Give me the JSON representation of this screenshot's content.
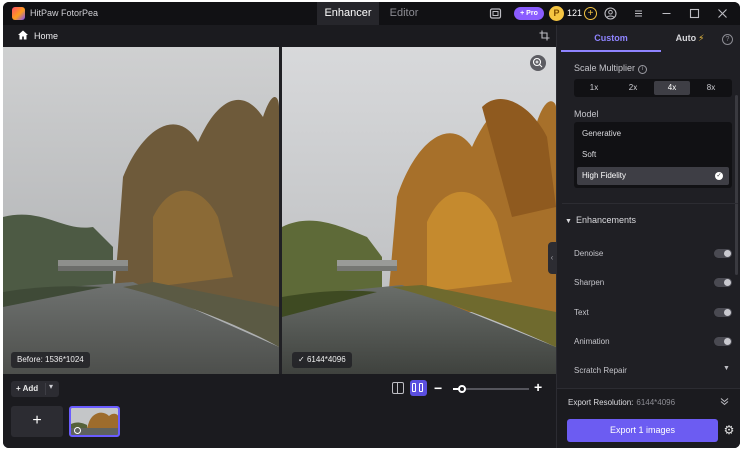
{
  "app": {
    "title": "HitPaw FotorPea",
    "tabs": [
      {
        "label": "Enhancer",
        "active": true
      },
      {
        "label": "Editor",
        "active": false
      }
    ],
    "pro_label": "+ Pro",
    "credits": "121",
    "icons": [
      "screen-icon",
      "coin-icon",
      "add-credits-icon",
      "account-icon",
      "menu-icon",
      "minimize-icon",
      "maximize-icon",
      "close-icon"
    ]
  },
  "breadcrumb": {
    "home_label": "Home"
  },
  "preview": {
    "before_label": "Before: 1536*1024",
    "after_label": "6144*4096",
    "after_check": "✓"
  },
  "toolbar": {
    "add_label": "+ Add",
    "add_caret": "▾",
    "zoom_minus": "−",
    "zoom_plus": "+",
    "zoom_level": 0.12
  },
  "thumbs": {
    "add_label": "+"
  },
  "panel": {
    "tabs": [
      {
        "label": "Custom",
        "active": true
      },
      {
        "label": "Auto",
        "active": false
      }
    ],
    "help": "?",
    "scale_label": "Scale Multiplier",
    "scale_options": [
      {
        "label": "1x",
        "active": false
      },
      {
        "label": "2x",
        "active": false
      },
      {
        "label": "4x",
        "active": true
      },
      {
        "label": "8x",
        "active": false
      }
    ],
    "model_label": "Model",
    "models": [
      {
        "label": "Generative",
        "selected": false
      },
      {
        "label": "Soft",
        "selected": false
      },
      {
        "label": "High Fidelity",
        "selected": true
      }
    ],
    "enhancements_label": "Enhancements",
    "enhancements": [
      {
        "label": "Denoise",
        "enabled": false
      },
      {
        "label": "Sharpen",
        "enabled": false
      },
      {
        "label": "Text",
        "enabled": false
      },
      {
        "label": "Animation",
        "enabled": false
      },
      {
        "label": "Scratch Repair",
        "enabled": null
      }
    ],
    "export_resolution_label": "Export Resolution:",
    "export_resolution_value": "6144*4096",
    "export_button": "Export 1 images"
  },
  "colors": {
    "accent": "#6c5cf2",
    "background": "#1b1b1f",
    "panel": "#1f1f24",
    "coin": "#f5c542"
  }
}
